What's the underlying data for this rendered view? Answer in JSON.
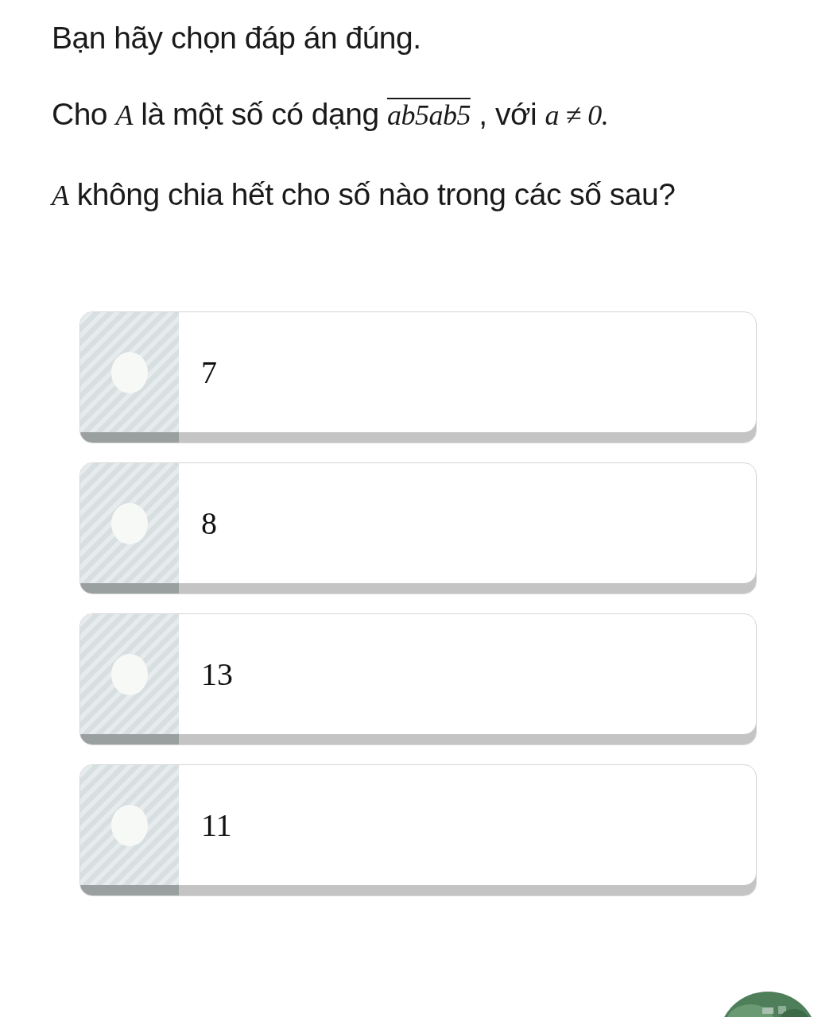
{
  "instruction": "Bạn hãy chọn đáp án đúng.",
  "question": [
    {
      "kind": "text",
      "text": "Cho "
    },
    {
      "kind": "math",
      "text": "A"
    },
    {
      "kind": "text",
      "text": " là một số có dạng "
    },
    {
      "kind": "overline",
      "text": "ab5ab5"
    },
    {
      "kind": "text",
      "text": " , với "
    },
    {
      "kind": "math",
      "text": "a ≠ 0."
    },
    {
      "kind": "break"
    },
    {
      "kind": "math",
      "text": "A"
    },
    {
      "kind": "text",
      "text": " không chia hết cho số nào trong các số sau?"
    }
  ],
  "options": [
    {
      "label": "7",
      "selected": false
    },
    {
      "label": "8",
      "selected": false
    },
    {
      "label": "13",
      "selected": false
    },
    {
      "label": "11",
      "selected": false
    }
  ]
}
